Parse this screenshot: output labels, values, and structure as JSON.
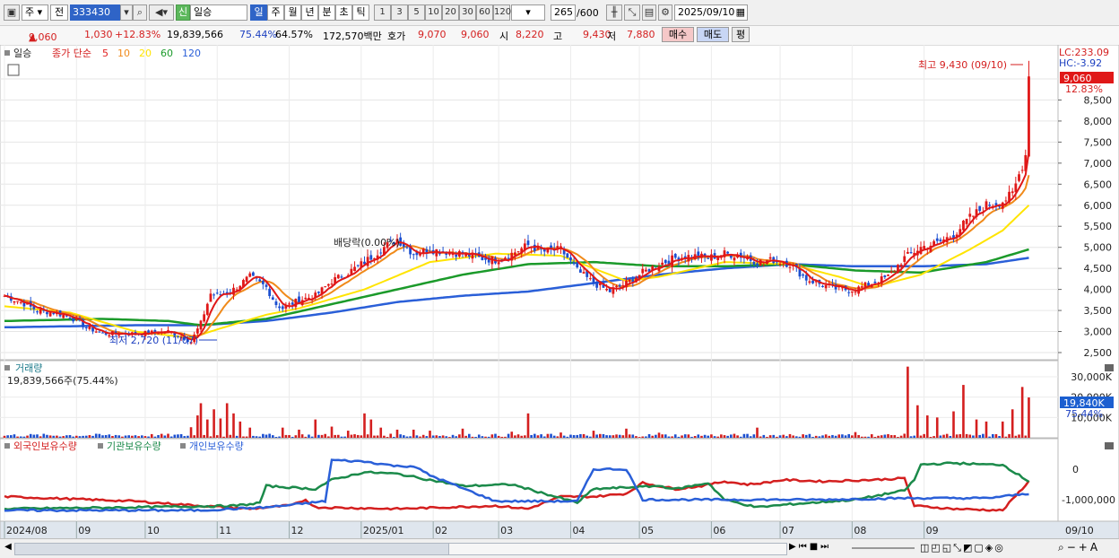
{
  "toolbar": {
    "market": "주",
    "prev": "전",
    "code": "333430",
    "badge": "신",
    "name": "일승",
    "periods": [
      "일",
      "주",
      "월",
      "년",
      "분",
      "초",
      "틱"
    ],
    "active_period": "일",
    "intervals": [
      "1",
      "3",
      "5",
      "10",
      "20",
      "30",
      "60",
      "120"
    ],
    "count": "265",
    "max": "/600",
    "date": "2025/09/10"
  },
  "quote": {
    "price": "9,060",
    "change": "1,030",
    "pct": "+12.83%",
    "volume": "19,839,566",
    "vol_ratio": "75.44%",
    "turnover": "64.57%",
    "amount": "172,570백만",
    "bid_label": "호가",
    "bid": "9,070",
    "ask": "9,060",
    "open_label": "시",
    "open": "8,220",
    "high_label": "고",
    "high": "9,430",
    "low_label": "저",
    "low": "7,880",
    "buy": "매수",
    "sell": "매도",
    "even": "평"
  },
  "price_panel": {
    "name": "일승",
    "legend_prefix": "종가 단순",
    "ma": [
      {
        "label": "5",
        "color": "#e02020"
      },
      {
        "label": "10",
        "color": "#f08a1a"
      },
      {
        "label": "20",
        "color": "#ffe400"
      },
      {
        "label": "60",
        "color": "#1b9a2a"
      },
      {
        "label": "120",
        "color": "#2a5fd8"
      }
    ],
    "lc": "LC:233.09",
    "hc": "HC:-3.92",
    "cur_price": "9,060",
    "cur_pct": "12.83%",
    "high_note": "최고 9,430 (09/10)",
    "low_note": "최저 2,720 (11/07)",
    "div_note": "배당락(0.00%)"
  },
  "volume_panel": {
    "title": "거래량",
    "value": "19,839,566주(75.44%)",
    "cur": "19,840K",
    "cur_pct": "75.44%"
  },
  "holders_panel": {
    "legend": [
      {
        "label": "외국인보유수량",
        "color": "#d41f1f"
      },
      {
        "label": "기관보유수량",
        "color": "#1b8a4a"
      },
      {
        "label": "개인보유수량",
        "color": "#2a5fd8"
      }
    ]
  },
  "x_labels": [
    "2024/08",
    "09",
    "10",
    "11",
    "12",
    "2025/01",
    "02",
    "03",
    "04",
    "05",
    "06",
    "07",
    "08",
    "09"
  ],
  "x_cur": "09/10",
  "chart_data": [
    {
      "type": "candlestick",
      "title": "일승",
      "y_ticks": [
        9000,
        8500,
        8000,
        7500,
        7000,
        6500,
        6000,
        5500,
        5000,
        4500,
        4000,
        3500,
        3000,
        2500
      ],
      "ylim": [
        2300,
        9700
      ],
      "x_labels": [
        "2024/08",
        "09",
        "10",
        "11",
        "12",
        "2025/01",
        "02",
        "03",
        "04",
        "05",
        "06",
        "07",
        "08",
        "09"
      ],
      "close_path": [
        [
          0,
          3850
        ],
        [
          5,
          3700
        ],
        [
          10,
          3500
        ],
        [
          15,
          3450
        ],
        [
          20,
          3350
        ],
        [
          25,
          3100
        ],
        [
          30,
          2950
        ],
        [
          40,
          2950
        ],
        [
          50,
          3000
        ],
        [
          55,
          2850
        ],
        [
          57,
          2760
        ],
        [
          60,
          3200
        ],
        [
          63,
          3900
        ],
        [
          65,
          3850
        ],
        [
          70,
          4000
        ],
        [
          75,
          4300
        ],
        [
          80,
          4050
        ],
        [
          83,
          3650
        ],
        [
          85,
          3550
        ],
        [
          90,
          3750
        ],
        [
          95,
          3850
        ],
        [
          100,
          4200
        ],
        [
          105,
          4400
        ],
        [
          110,
          4650
        ],
        [
          115,
          4950
        ],
        [
          120,
          5200
        ],
        [
          125,
          4850
        ],
        [
          130,
          4950
        ],
        [
          140,
          4850
        ],
        [
          145,
          4750
        ],
        [
          150,
          4700
        ],
        [
          155,
          4850
        ],
        [
          160,
          5050
        ],
        [
          165,
          4900
        ],
        [
          170,
          4950
        ],
        [
          175,
          4450
        ],
        [
          180,
          4150
        ],
        [
          185,
          3950
        ],
        [
          190,
          4150
        ],
        [
          195,
          4400
        ],
        [
          200,
          4600
        ],
        [
          205,
          4750
        ],
        [
          210,
          4800
        ],
        [
          215,
          4750
        ],
        [
          220,
          4850
        ],
        [
          225,
          4800
        ],
        [
          230,
          4650
        ],
        [
          235,
          4700
        ],
        [
          240,
          4600
        ],
        [
          245,
          4250
        ],
        [
          250,
          4100
        ],
        [
          255,
          4000
        ],
        [
          260,
          4000
        ],
        [
          265,
          4150
        ],
        [
          270,
          4300
        ],
        [
          275,
          4750
        ],
        [
          280,
          5000
        ],
        [
          285,
          5100
        ],
        [
          290,
          5300
        ],
        [
          295,
          5700
        ],
        [
          300,
          6000
        ],
        [
          305,
          6100
        ],
        [
          308,
          6250
        ],
        [
          312,
          7200
        ],
        [
          313,
          9060
        ]
      ],
      "ma20_path": [
        [
          0,
          3600
        ],
        [
          20,
          3450
        ],
        [
          40,
          3000
        ],
        [
          57,
          2850
        ],
        [
          65,
          3050
        ],
        [
          80,
          3400
        ],
        [
          90,
          3550
        ],
        [
          110,
          4000
        ],
        [
          130,
          4650
        ],
        [
          150,
          4850
        ],
        [
          170,
          4800
        ],
        [
          180,
          4500
        ],
        [
          190,
          4200
        ],
        [
          200,
          4300
        ],
        [
          220,
          4650
        ],
        [
          240,
          4600
        ],
        [
          255,
          4300
        ],
        [
          265,
          4050
        ],
        [
          280,
          4350
        ],
        [
          295,
          4950
        ],
        [
          305,
          5400
        ],
        [
          313,
          6000
        ]
      ],
      "ma60_path": [
        [
          0,
          3250
        ],
        [
          30,
          3300
        ],
        [
          50,
          3250
        ],
        [
          60,
          3150
        ],
        [
          80,
          3300
        ],
        [
          100,
          3650
        ],
        [
          120,
          4000
        ],
        [
          140,
          4350
        ],
        [
          160,
          4600
        ],
        [
          180,
          4650
        ],
        [
          200,
          4550
        ],
        [
          220,
          4550
        ],
        [
          240,
          4600
        ],
        [
          260,
          4450
        ],
        [
          280,
          4400
        ],
        [
          300,
          4650
        ],
        [
          313,
          4950
        ]
      ],
      "ma120_path": [
        [
          0,
          3100
        ],
        [
          40,
          3150
        ],
        [
          60,
          3150
        ],
        [
          80,
          3250
        ],
        [
          100,
          3450
        ],
        [
          120,
          3700
        ],
        [
          140,
          3850
        ],
        [
          160,
          3950
        ],
        [
          180,
          4150
        ],
        [
          200,
          4350
        ],
        [
          220,
          4500
        ],
        [
          240,
          4600
        ],
        [
          260,
          4550
        ],
        [
          280,
          4550
        ],
        [
          300,
          4600
        ],
        [
          313,
          4750
        ]
      ],
      "high": {
        "value": 9430,
        "label": "최고 9,430 (09/10)"
      },
      "low": {
        "value": 2720,
        "label": "최저 2,720 (11/07)"
      },
      "last": 9060
    },
    {
      "type": "bar",
      "title": "거래량",
      "y_ticks": [
        30000,
        20000,
        10000
      ],
      "unit": "K",
      "ylim": [
        0,
        36000
      ],
      "spikes": [
        [
          57,
          5200
        ],
        [
          59,
          11000
        ],
        [
          60,
          17000
        ],
        [
          62,
          9000
        ],
        [
          64,
          14000
        ],
        [
          66,
          9500
        ],
        [
          68,
          17000
        ],
        [
          70,
          12000
        ],
        [
          72,
          8000
        ],
        [
          75,
          5000
        ],
        [
          85,
          5000
        ],
        [
          90,
          4000
        ],
        [
          95,
          9000
        ],
        [
          100,
          5500
        ],
        [
          105,
          3500
        ],
        [
          110,
          12000
        ],
        [
          112,
          9000
        ],
        [
          115,
          5000
        ],
        [
          120,
          4000
        ],
        [
          125,
          4000
        ],
        [
          130,
          3500
        ],
        [
          140,
          4500
        ],
        [
          155,
          3000
        ],
        [
          160,
          12000
        ],
        [
          170,
          2600
        ],
        [
          180,
          3500
        ],
        [
          190,
          4500
        ],
        [
          200,
          2500
        ],
        [
          230,
          5000
        ],
        [
          240,
          1800
        ],
        [
          260,
          2800
        ],
        [
          276,
          35000
        ],
        [
          279,
          16000
        ],
        [
          282,
          11000
        ],
        [
          285,
          10000
        ],
        [
          290,
          13000
        ],
        [
          293,
          26000
        ],
        [
          297,
          9000
        ],
        [
          300,
          8000
        ],
        [
          305,
          8000
        ],
        [
          308,
          14000
        ],
        [
          311,
          25000
        ],
        [
          313,
          19840
        ]
      ],
      "last": 19840
    },
    {
      "type": "line",
      "title": "보유수량",
      "y_ticks": [
        0,
        -1000000
      ],
      "ylim": [
        -1400000,
        200000
      ],
      "series": [
        {
          "name": "외국인보유수량",
          "color": "#d41f1f",
          "values": [
            [
              0,
              -900000
            ],
            [
              40,
              -1050000
            ],
            [
              60,
              -1200000
            ],
            [
              75,
              -1300000
            ],
            [
              88,
              -1180000
            ],
            [
              92,
              -1000000
            ],
            [
              95,
              -1250000
            ],
            [
              120,
              -1300000
            ],
            [
              150,
              -1200000
            ],
            [
              160,
              -1300000
            ],
            [
              170,
              -900000
            ],
            [
              180,
              -900000
            ],
            [
              190,
              -800000
            ],
            [
              195,
              -450000
            ],
            [
              205,
              -650000
            ],
            [
              213,
              -550000
            ],
            [
              220,
              -400000
            ],
            [
              227,
              -500000
            ],
            [
              232,
              -450000
            ],
            [
              238,
              -350000
            ],
            [
              250,
              -400000
            ],
            [
              265,
              -350000
            ],
            [
              275,
              -300000
            ],
            [
              278,
              -1200000
            ],
            [
              290,
              -1300000
            ],
            [
              305,
              -1350000
            ],
            [
              313,
              -400000
            ]
          ]
        },
        {
          "name": "기관보유수량",
          "color": "#1b8a4a",
          "values": [
            [
              0,
              -1300000
            ],
            [
              40,
              -1250000
            ],
            [
              70,
              -1200000
            ],
            [
              75,
              -1150000
            ],
            [
              78,
              -1100000
            ],
            [
              80,
              -550000
            ],
            [
              95,
              -650000
            ],
            [
              100,
              -350000
            ],
            [
              110,
              -100000
            ],
            [
              120,
              -150000
            ],
            [
              140,
              -550000
            ],
            [
              155,
              -500000
            ],
            [
              175,
              -1100000
            ],
            [
              180,
              -650000
            ],
            [
              200,
              -550000
            ],
            [
              205,
              -650000
            ],
            [
              215,
              -450000
            ],
            [
              220,
              -1000000
            ],
            [
              230,
              -1250000
            ],
            [
              240,
              -1150000
            ],
            [
              260,
              -1000000
            ],
            [
              275,
              -700000
            ],
            [
              278,
              -350000
            ],
            [
              280,
              150000
            ],
            [
              290,
              200000
            ],
            [
              300,
              150000
            ],
            [
              305,
              150000
            ],
            [
              313,
              -400000
            ]
          ]
        },
        {
          "name": "개인보유수량",
          "color": "#2a5fd8",
          "values": [
            [
              0,
              -1350000
            ],
            [
              60,
              -1350000
            ],
            [
              80,
              -1250000
            ],
            [
              85,
              -1200000
            ],
            [
              98,
              -1050000
            ],
            [
              100,
              300000
            ],
            [
              110,
              250000
            ],
            [
              120,
              100000
            ],
            [
              125,
              100000
            ],
            [
              130,
              -200000
            ],
            [
              150,
              -1050000
            ],
            [
              175,
              -1050000
            ],
            [
              180,
              0
            ],
            [
              190,
              0
            ],
            [
              195,
              -1000000
            ],
            [
              250,
              -1000000
            ],
            [
              275,
              -950000
            ],
            [
              278,
              -950000
            ],
            [
              300,
              -950000
            ],
            [
              313,
              -800000
            ]
          ]
        }
      ]
    }
  ]
}
